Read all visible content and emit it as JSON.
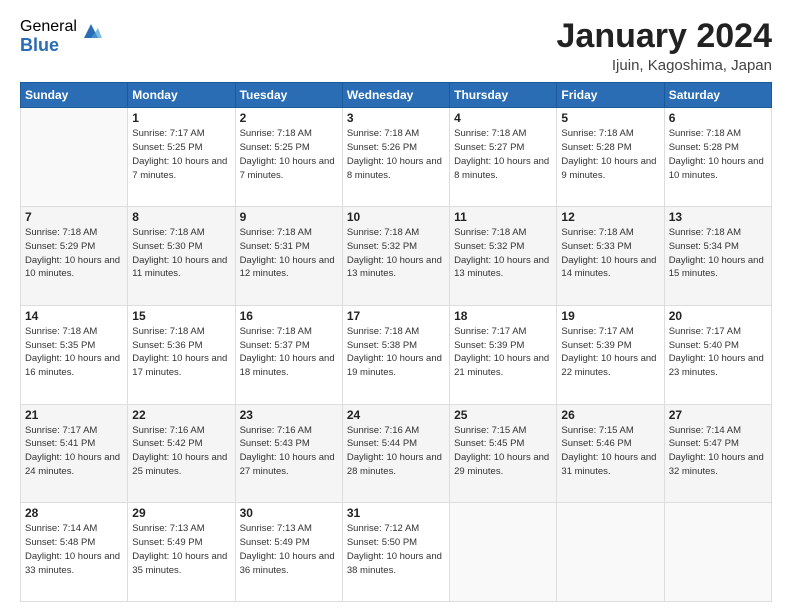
{
  "logo": {
    "general": "General",
    "blue": "Blue"
  },
  "title": "January 2024",
  "location": "Ijuin, Kagoshima, Japan",
  "weekdays": [
    "Sunday",
    "Monday",
    "Tuesday",
    "Wednesday",
    "Thursday",
    "Friday",
    "Saturday"
  ],
  "weeks": [
    [
      {
        "day": "",
        "info": ""
      },
      {
        "day": "1",
        "info": "Sunrise: 7:17 AM\nSunset: 5:25 PM\nDaylight: 10 hours\nand 7 minutes."
      },
      {
        "day": "2",
        "info": "Sunrise: 7:18 AM\nSunset: 5:25 PM\nDaylight: 10 hours\nand 7 minutes."
      },
      {
        "day": "3",
        "info": "Sunrise: 7:18 AM\nSunset: 5:26 PM\nDaylight: 10 hours\nand 8 minutes."
      },
      {
        "day": "4",
        "info": "Sunrise: 7:18 AM\nSunset: 5:27 PM\nDaylight: 10 hours\nand 8 minutes."
      },
      {
        "day": "5",
        "info": "Sunrise: 7:18 AM\nSunset: 5:28 PM\nDaylight: 10 hours\nand 9 minutes."
      },
      {
        "day": "6",
        "info": "Sunrise: 7:18 AM\nSunset: 5:28 PM\nDaylight: 10 hours\nand 10 minutes."
      }
    ],
    [
      {
        "day": "7",
        "info": "Sunrise: 7:18 AM\nSunset: 5:29 PM\nDaylight: 10 hours\nand 10 minutes."
      },
      {
        "day": "8",
        "info": "Sunrise: 7:18 AM\nSunset: 5:30 PM\nDaylight: 10 hours\nand 11 minutes."
      },
      {
        "day": "9",
        "info": "Sunrise: 7:18 AM\nSunset: 5:31 PM\nDaylight: 10 hours\nand 12 minutes."
      },
      {
        "day": "10",
        "info": "Sunrise: 7:18 AM\nSunset: 5:32 PM\nDaylight: 10 hours\nand 13 minutes."
      },
      {
        "day": "11",
        "info": "Sunrise: 7:18 AM\nSunset: 5:32 PM\nDaylight: 10 hours\nand 13 minutes."
      },
      {
        "day": "12",
        "info": "Sunrise: 7:18 AM\nSunset: 5:33 PM\nDaylight: 10 hours\nand 14 minutes."
      },
      {
        "day": "13",
        "info": "Sunrise: 7:18 AM\nSunset: 5:34 PM\nDaylight: 10 hours\nand 15 minutes."
      }
    ],
    [
      {
        "day": "14",
        "info": "Sunrise: 7:18 AM\nSunset: 5:35 PM\nDaylight: 10 hours\nand 16 minutes."
      },
      {
        "day": "15",
        "info": "Sunrise: 7:18 AM\nSunset: 5:36 PM\nDaylight: 10 hours\nand 17 minutes."
      },
      {
        "day": "16",
        "info": "Sunrise: 7:18 AM\nSunset: 5:37 PM\nDaylight: 10 hours\nand 18 minutes."
      },
      {
        "day": "17",
        "info": "Sunrise: 7:18 AM\nSunset: 5:38 PM\nDaylight: 10 hours\nand 19 minutes."
      },
      {
        "day": "18",
        "info": "Sunrise: 7:17 AM\nSunset: 5:39 PM\nDaylight: 10 hours\nand 21 minutes."
      },
      {
        "day": "19",
        "info": "Sunrise: 7:17 AM\nSunset: 5:39 PM\nDaylight: 10 hours\nand 22 minutes."
      },
      {
        "day": "20",
        "info": "Sunrise: 7:17 AM\nSunset: 5:40 PM\nDaylight: 10 hours\nand 23 minutes."
      }
    ],
    [
      {
        "day": "21",
        "info": "Sunrise: 7:17 AM\nSunset: 5:41 PM\nDaylight: 10 hours\nand 24 minutes."
      },
      {
        "day": "22",
        "info": "Sunrise: 7:16 AM\nSunset: 5:42 PM\nDaylight: 10 hours\nand 25 minutes."
      },
      {
        "day": "23",
        "info": "Sunrise: 7:16 AM\nSunset: 5:43 PM\nDaylight: 10 hours\nand 27 minutes."
      },
      {
        "day": "24",
        "info": "Sunrise: 7:16 AM\nSunset: 5:44 PM\nDaylight: 10 hours\nand 28 minutes."
      },
      {
        "day": "25",
        "info": "Sunrise: 7:15 AM\nSunset: 5:45 PM\nDaylight: 10 hours\nand 29 minutes."
      },
      {
        "day": "26",
        "info": "Sunrise: 7:15 AM\nSunset: 5:46 PM\nDaylight: 10 hours\nand 31 minutes."
      },
      {
        "day": "27",
        "info": "Sunrise: 7:14 AM\nSunset: 5:47 PM\nDaylight: 10 hours\nand 32 minutes."
      }
    ],
    [
      {
        "day": "28",
        "info": "Sunrise: 7:14 AM\nSunset: 5:48 PM\nDaylight: 10 hours\nand 33 minutes."
      },
      {
        "day": "29",
        "info": "Sunrise: 7:13 AM\nSunset: 5:49 PM\nDaylight: 10 hours\nand 35 minutes."
      },
      {
        "day": "30",
        "info": "Sunrise: 7:13 AM\nSunset: 5:49 PM\nDaylight: 10 hours\nand 36 minutes."
      },
      {
        "day": "31",
        "info": "Sunrise: 7:12 AM\nSunset: 5:50 PM\nDaylight: 10 hours\nand 38 minutes."
      },
      {
        "day": "",
        "info": ""
      },
      {
        "day": "",
        "info": ""
      },
      {
        "day": "",
        "info": ""
      }
    ]
  ]
}
